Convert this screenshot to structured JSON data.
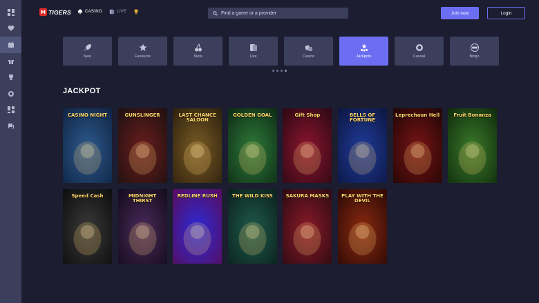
{
  "brand": {
    "mark": "M",
    "name": "TIGERS"
  },
  "top_nav": {
    "casino": "CASINO",
    "live": "LIVE"
  },
  "search": {
    "placeholder": "Find a game or a provider"
  },
  "auth": {
    "join": "Join now",
    "login": "Login"
  },
  "sidebar": {
    "icons": [
      "grid-icon",
      "heart-icon",
      "calendar-icon",
      "gift-icon",
      "trophy-icon",
      "lifebuoy-icon",
      "dashboard-icon",
      "chat-icon"
    ],
    "active_index": 2
  },
  "categories": [
    {
      "label": "New",
      "icon": "rocket-icon"
    },
    {
      "label": "Favourite",
      "icon": "star-icon"
    },
    {
      "label": "Slots",
      "icon": "cherry-icon"
    },
    {
      "label": "Live",
      "icon": "cards-icon"
    },
    {
      "label": "Casino",
      "icon": "dice-icon"
    },
    {
      "label": "Jackpots",
      "icon": "jackpot-icon",
      "active": true
    },
    {
      "label": "Casual",
      "icon": "ring-icon"
    },
    {
      "label": "Bingo",
      "icon": "bingo-icon"
    }
  ],
  "carousel_dots": {
    "count": 4,
    "active_index": 3
  },
  "section": {
    "title": "JACKPOT"
  },
  "games": [
    {
      "title": "CASINO NIGHT",
      "colors": [
        "#2d5a8e",
        "#0f2342"
      ]
    },
    {
      "title": "GUNSLINGER",
      "colors": [
        "#6b1d1d",
        "#1c1010"
      ]
    },
    {
      "title": "LAST CHANCE SALOON",
      "colors": [
        "#7a5b26",
        "#2b1f0c"
      ]
    },
    {
      "title": "GOLDEN GOAL",
      "colors": [
        "#2f7a3a",
        "#0c2a14"
      ]
    },
    {
      "title": "Gift Shop",
      "colors": [
        "#8e1530",
        "#2a0812"
      ]
    },
    {
      "title": "BELLS OF FORTUNE",
      "colors": [
        "#203c9a",
        "#0c1540"
      ]
    },
    {
      "title": "Leprechaun Hell",
      "colors": [
        "#7a1414",
        "#1f0505"
      ]
    },
    {
      "title": "Fruit Bonanza",
      "colors": [
        "#3a7a2a",
        "#0f2a0c"
      ]
    },
    {
      "title": "Speed Cash",
      "colors": [
        "#3a3a3a",
        "#0c0c0c"
      ]
    },
    {
      "title": "MIDNIGHT THIRST",
      "colors": [
        "#4a2a5a",
        "#120a1a"
      ]
    },
    {
      "title": "REDLINE RUSH",
      "colors": [
        "#2a2ad8",
        "#5a0c5a"
      ]
    },
    {
      "title": "THE WILD KISS",
      "colors": [
        "#1e5a4a",
        "#0a1f1c"
      ]
    },
    {
      "title": "SAKURA MASKS",
      "colors": [
        "#8a1a2a",
        "#2a0a10"
      ]
    },
    {
      "title": "PLAY WITH THE DEVIL",
      "colors": [
        "#8a2a10",
        "#2a0805"
      ]
    }
  ]
}
